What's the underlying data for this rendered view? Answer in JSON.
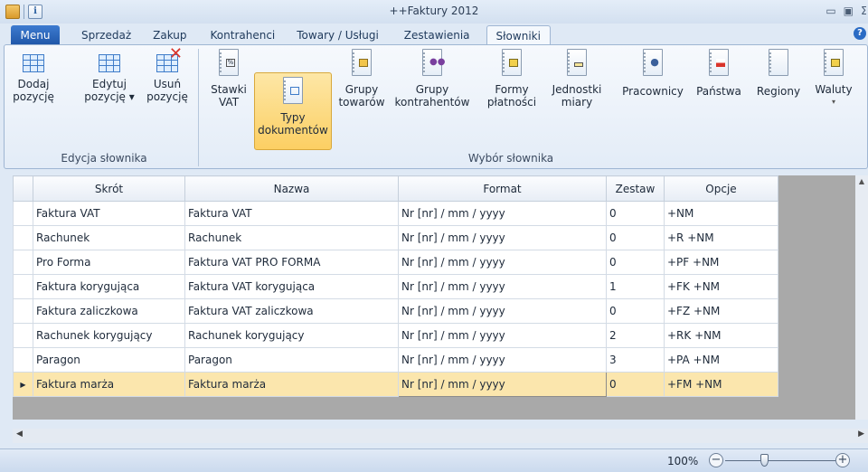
{
  "window": {
    "title": "++Faktury 2012",
    "quick_access": [
      "app-icon",
      "info-icon"
    ],
    "controls": [
      "minimize-icon",
      "restore-icon",
      "close-icon"
    ]
  },
  "menu_button": "Menu",
  "tabs": [
    "Sprzedaż",
    "Zakup",
    "Kontrahenci",
    "Towary / Usługi",
    "Zestawienia",
    "Słowniki"
  ],
  "active_tab": "Słowniki",
  "ribbon": {
    "edit_group": {
      "label": "Edycja słownika",
      "buttons": [
        {
          "line1": "Dodaj",
          "line2": "pozycję",
          "icon": "add-row-icon"
        },
        {
          "line1": "Edytuj",
          "line2": "pozycję ▾",
          "icon": "edit-row-icon"
        },
        {
          "line1": "Usuń",
          "line2": "pozycję",
          "icon": "delete-row-icon"
        }
      ]
    },
    "choose_group": {
      "label": "Wybór słownika",
      "buttons": [
        {
          "line1": "Stawki",
          "line2": "VAT",
          "icon": "vat-rates-icon"
        },
        {
          "line1": "Typy",
          "line2": "dokumentów",
          "icon": "document-types-icon",
          "selected": true
        },
        {
          "line1": "Grupy",
          "line2": "towarów",
          "icon": "product-groups-icon"
        },
        {
          "line1": "Grupy",
          "line2": "kontrahentów",
          "icon": "contractor-groups-icon"
        },
        {
          "line1": "Formy",
          "line2": "płatności",
          "icon": "payment-forms-icon"
        },
        {
          "line1": "Jednostki",
          "line2": "miary",
          "icon": "units-icon"
        },
        {
          "line1": "Pracownicy",
          "line2": "",
          "icon": "employees-icon"
        },
        {
          "line1": "Państwa",
          "line2": "",
          "icon": "countries-icon"
        },
        {
          "line1": "Regiony",
          "line2": "",
          "icon": "regions-icon"
        },
        {
          "line1": "Waluty",
          "line2": "▾",
          "icon": "currencies-icon"
        }
      ]
    }
  },
  "table": {
    "columns": [
      "Skrót",
      "Nazwa",
      "Format",
      "Zestaw",
      "Opcje"
    ],
    "rows": [
      [
        "Faktura VAT",
        "Faktura VAT",
        "Nr [nr] / mm / yyyy",
        "0",
        "+NM"
      ],
      [
        "Rachunek",
        "Rachunek",
        "Nr [nr] / mm / yyyy",
        "0",
        "+R +NM"
      ],
      [
        "Pro Forma",
        "Faktura VAT PRO FORMA",
        "Nr [nr] / mm / yyyy",
        "0",
        "+PF +NM"
      ],
      [
        "Faktura korygująca",
        "Faktura VAT korygująca",
        "Nr [nr] / mm / yyyy",
        "1",
        "+FK +NM"
      ],
      [
        "Faktura zaliczkowa",
        "Faktura VAT zaliczkowa",
        "Nr [nr] / mm / yyyy",
        "0",
        "+FZ +NM"
      ],
      [
        "Rachunek korygujący",
        "Rachunek korygujący",
        "Nr [nr] / mm / yyyy",
        "2",
        "+RK +NM"
      ],
      [
        "Paragon",
        "Paragon",
        "Nr [nr] / mm / yyyy",
        "3",
        "+PA +NM"
      ],
      [
        "Faktura marża",
        "Faktura marża",
        "Nr [nr] / mm / yyyy",
        "0",
        "+FM +NM"
      ]
    ],
    "selected_row": 7,
    "row_indicator": "▶"
  },
  "status_bar": {
    "zoom": "100%",
    "zoom_minus": "−",
    "zoom_plus": "+"
  }
}
